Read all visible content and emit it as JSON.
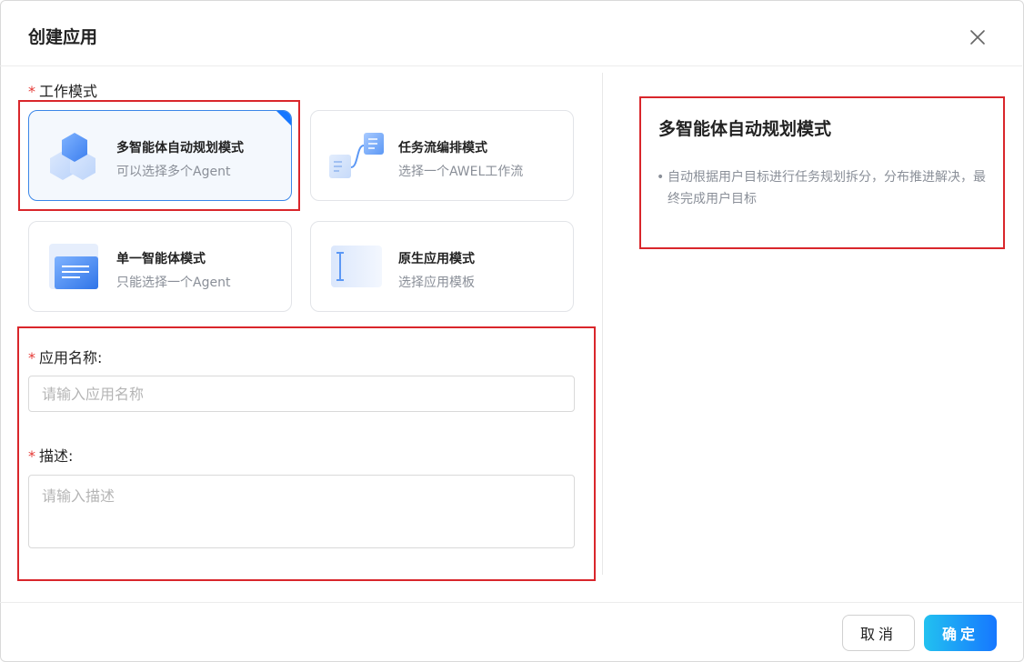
{
  "dialog": {
    "title": "创建应用",
    "close_icon": "close-icon"
  },
  "mode_section": {
    "label": "工作模式",
    "required": "*",
    "cards": [
      {
        "title": "多智能体自动规划模式",
        "subtitle": "可以选择多个Agent",
        "icon": "hexagon-cluster-icon",
        "selected": true
      },
      {
        "title": "任务流编排模式",
        "subtitle": "选择一个AWEL工作流",
        "icon": "workflow-icon",
        "selected": false
      },
      {
        "title": "单一智能体模式",
        "subtitle": "只能选择一个Agent",
        "icon": "document-card-icon",
        "selected": false
      },
      {
        "title": "原生应用模式",
        "subtitle": "选择应用模板",
        "icon": "text-cursor-icon",
        "selected": false
      }
    ]
  },
  "form": {
    "name_label": "应用名称:",
    "name_placeholder": "请输入应用名称",
    "name_value": "",
    "desc_label": "描述:",
    "desc_placeholder": "请输入描述",
    "desc_value": "",
    "required": "*"
  },
  "detail": {
    "title": "多智能体自动规划模式",
    "bullet": "•",
    "description": "自动根据用户目标进行任务规划拆分，分布推进解决，最终完成用户目标"
  },
  "footer": {
    "cancel_label": "取消",
    "ok_label": "确定"
  },
  "colors": {
    "accent": "#1677ff",
    "required": "#e53935",
    "annotation": "#d9262b"
  }
}
